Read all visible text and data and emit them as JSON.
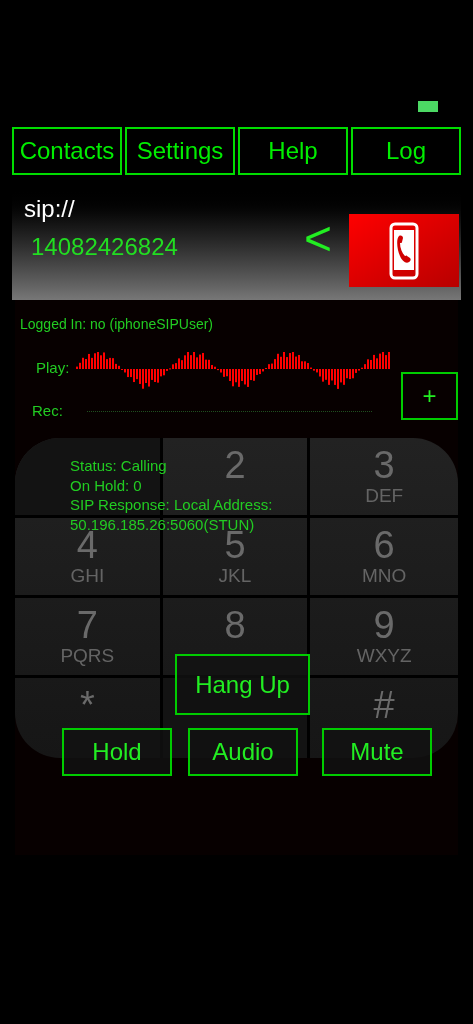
{
  "tabs": [
    {
      "label": "Contacts"
    },
    {
      "label": "Settings"
    },
    {
      "label": "Help"
    },
    {
      "label": "Log"
    }
  ],
  "address": {
    "scheme": "sip://",
    "number": "14082426824",
    "back": "<"
  },
  "login_status": "Logged In: no (iphoneSIPUser)",
  "meters": [
    {
      "label": "Play:"
    },
    {
      "label": "Rec:"
    }
  ],
  "add_button": "+",
  "keypad": [
    {
      "kind": "covered"
    },
    {
      "digit": "2"
    },
    {
      "digit": "3",
      "letters": "DEF"
    },
    {
      "digit": "4",
      "letters": "GHI"
    },
    {
      "digit": "5",
      "letters": "JKL"
    },
    {
      "digit": "6",
      "letters": "MNO"
    },
    {
      "digit": "7",
      "letters": "PQRS"
    },
    {
      "digit": "8"
    },
    {
      "digit": "9",
      "letters": "WXYZ"
    },
    {
      "digit": "*"
    },
    {
      "kind": "covered"
    },
    {
      "digit": "#"
    }
  ],
  "status_lines": [
    "Status: Calling",
    "On Hold: 0",
    "SIP Response: Local Address:",
    "50.196.185.26:5060(STUN)"
  ],
  "hang_up": "Hang Up",
  "call_buttons": [
    "Hold",
    "Audio",
    "Mute"
  ]
}
